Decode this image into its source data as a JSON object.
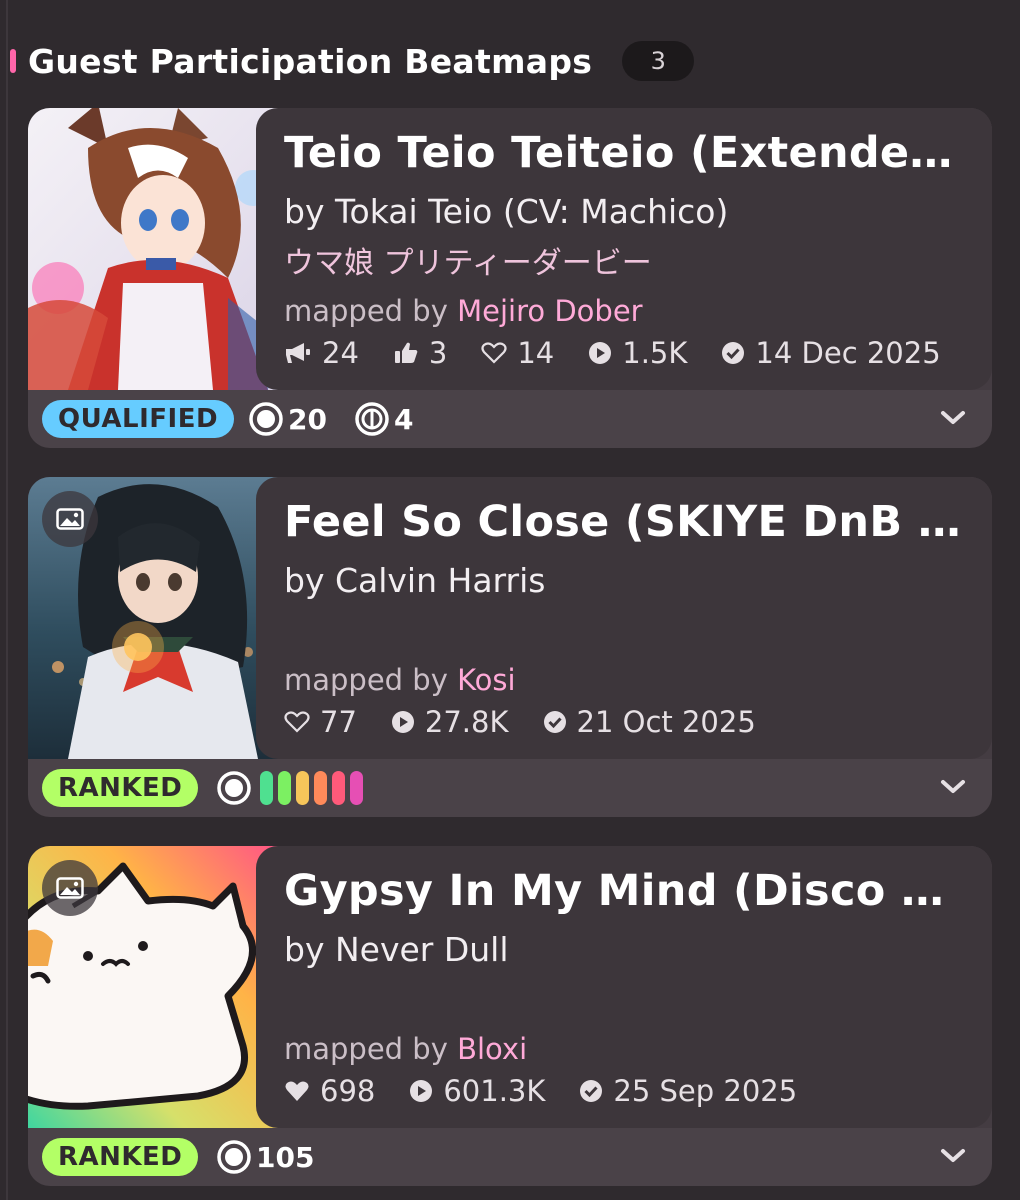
{
  "section": {
    "title": "Guest Participation Beatmaps",
    "count": "3"
  },
  "colors": {
    "accent": "#ff66aa",
    "qualified": "#66ccff",
    "ranked": "#b3ff66",
    "mapper": "#ffaad8",
    "diff_dots": [
      "#4fe090",
      "#7cf062",
      "#f6c55a",
      "#ff8a5a",
      "#ff5a7a",
      "#e64fb4"
    ]
  },
  "beatmaps": [
    {
      "title": "Teio Teio Teiteio (Extended...",
      "artist": "by Tokai Teio (CV: Machico)",
      "source": "ウマ娘 プリティーダービー",
      "mapped_prefix": "mapped by",
      "mapper": "Mejiro Dober",
      "stats": {
        "nominations": "24",
        "hype": "3",
        "favourites": "14",
        "plays": "1.5K",
        "date": "14 Dec 2025"
      },
      "status": "QUALIFIED",
      "diffs": [
        {
          "icon": "osu-standard-icon",
          "count": "20"
        },
        {
          "icon": "osu-taiko-icon",
          "count": "4"
        }
      ]
    },
    {
      "title": "Feel So Close (SKIYE DnB R...",
      "artist": "by Calvin Harris",
      "mapped_prefix": "mapped by",
      "mapper": "Kosi",
      "stats": {
        "favourites": "77",
        "plays": "27.8K",
        "date": "21 Oct 2025"
      },
      "status": "RANKED",
      "diff_count": 6
    },
    {
      "title": "Gypsy In My Mind (Disco R...",
      "artist": "by Never Dull",
      "mapped_prefix": "mapped by",
      "mapper": "Bloxi",
      "stats": {
        "favourites": "698",
        "plays": "601.3K",
        "date": "25 Sep 2025"
      },
      "status": "RANKED",
      "diffs": [
        {
          "icon": "osu-standard-icon",
          "count": "105"
        }
      ]
    }
  ]
}
